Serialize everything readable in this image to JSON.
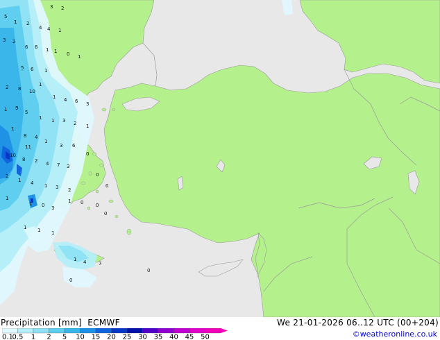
{
  "header": {
    "product": "Precipitation [mm]",
    "model": "ECMWF",
    "valid_time": "We 21-01-2026 06..12 UTC (00+204)"
  },
  "footer": {
    "copyright": "©weatheronline.co.uk"
  },
  "colors": {
    "sea": "#e8e8e8",
    "land": "#b4f08c",
    "border": "#9a9a9a"
  },
  "legend": {
    "ticks": [
      "0.1",
      "0.5",
      "1",
      "2",
      "5",
      "10",
      "15",
      "20",
      "25",
      "30",
      "35",
      "40",
      "45",
      "50"
    ],
    "colors": [
      "#e0f8ff",
      "#b4eef8",
      "#8ee0f4",
      "#5ecdee",
      "#38b4ea",
      "#1e90e6",
      "#1064dc",
      "#0838c8",
      "#0010a8",
      "#5000c8",
      "#9000d0",
      "#c000d0",
      "#e000c8",
      "#f000b8"
    ]
  },
  "map_labels": [
    "3",
    "2",
    "5",
    "1",
    "2",
    "4",
    "4",
    "1",
    "3",
    "2",
    "6",
    "1",
    "1",
    "0",
    "6",
    "1",
    "5",
    "6",
    "1",
    "2",
    "8",
    "1",
    "10",
    "1",
    "9",
    "5",
    "1",
    "4",
    "6",
    "3",
    "1",
    "1",
    "3",
    "2",
    "1",
    "1",
    "8",
    "4",
    "11",
    "1",
    "3",
    "6",
    "10",
    "8",
    "2",
    "4",
    "7",
    "3",
    "2",
    "1",
    "4",
    "1",
    "3",
    "2",
    "1",
    "1",
    "0",
    "3",
    "1",
    "1",
    "1",
    "1",
    "4",
    "7",
    "1",
    "0",
    "0",
    "0",
    "0",
    "0",
    "0",
    "0",
    "0"
  ]
}
